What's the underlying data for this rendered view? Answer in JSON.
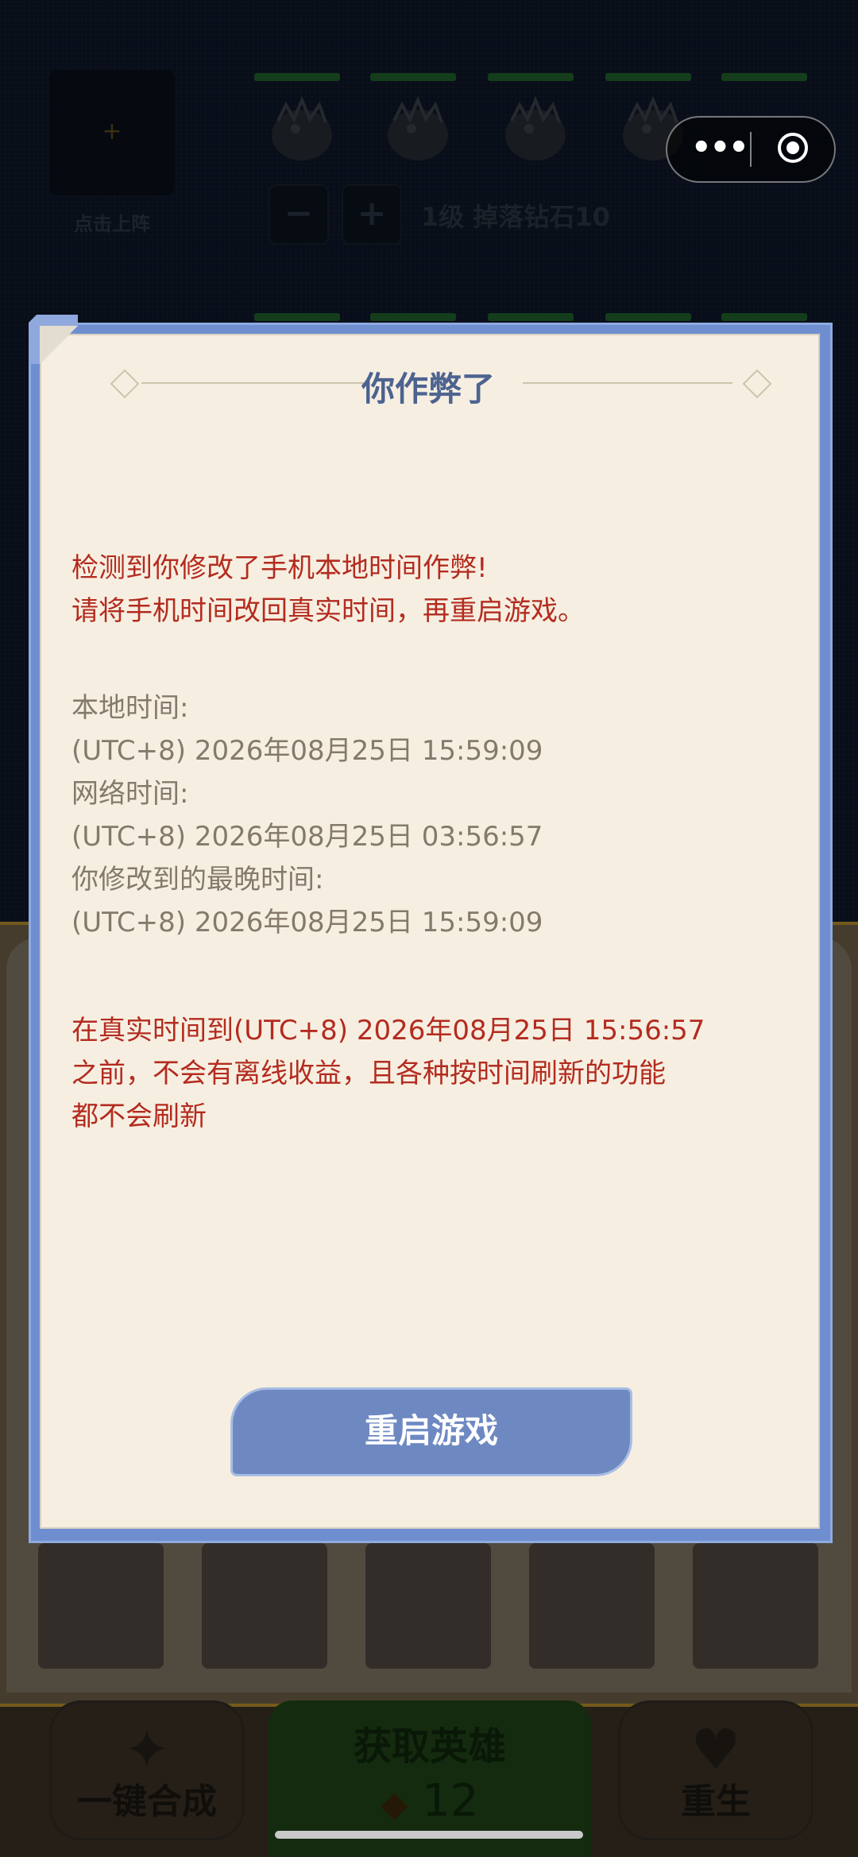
{
  "background": {
    "slot_label": "点击上阵",
    "slot_plus": "+",
    "minus": "−",
    "plus": "+",
    "level_text": "1级 掉落钻石10",
    "merge_label": "一键合成",
    "hero_title": "获取英雄",
    "hero_cost": "12",
    "rebirth_label": "重生"
  },
  "capsule": {
    "more_icon": "more-dots-icon",
    "close_icon": "target-close-icon",
    "more_text": "•••"
  },
  "dialog": {
    "title": "你作弊了",
    "warning_line1": "检测到你修改了手机本地时间作弊!",
    "warning_line2": "请将手机时间改回真实时间，再重启游戏。",
    "local_time_label": "本地时间:",
    "local_time_value": "(UTC+8) 2026年08月25日 15:59:09",
    "network_time_label": "网络时间:",
    "network_time_value": "(UTC+8) 2026年08月25日 03:56:57",
    "latest_time_label": "你修改到的最晚时间:",
    "latest_time_value": "(UTC+8) 2026年08月25日 15:59:09",
    "notice_line1": "在真实时间到(UTC+8) 2026年08月25日 15:56:57",
    "notice_line2": "之前，不会有离线收益，且各种按时间刷新的功能",
    "notice_line3": "都不会刷新",
    "restart_button": "重启游戏"
  },
  "colors": {
    "dialog_frame": "#6e8ed0",
    "paper": "#f6efe1",
    "title": "#4d6390",
    "warning_red": "#b42b1f",
    "info_gray": "#85796c",
    "button_blue": "#6e89c2"
  }
}
